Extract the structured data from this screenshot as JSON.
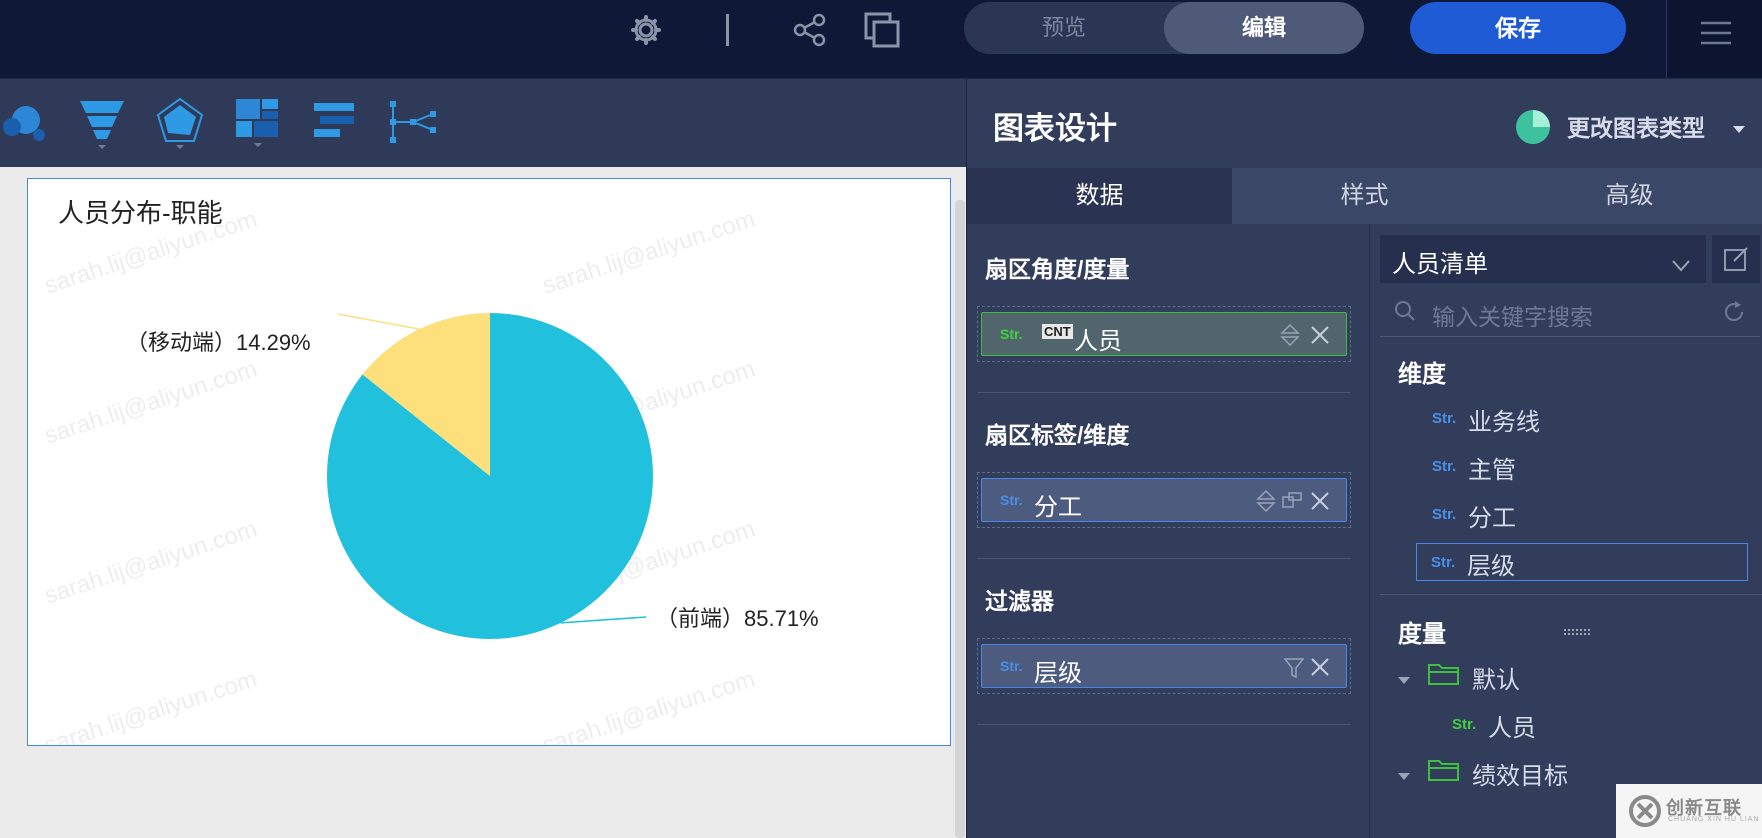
{
  "topbar": {
    "mode_tabs": [
      {
        "label": "预览",
        "active": false
      },
      {
        "label": "编辑",
        "active": true
      }
    ],
    "save_label": "保存",
    "icons": [
      "gear-icon",
      "share-icon",
      "copy-icon",
      "menu-icon"
    ]
  },
  "toolbar": {
    "chart_type_icons": [
      "bubble-chart-icon",
      "funnel-chart-icon",
      "radar-chart-icon",
      "treemap-chart-icon",
      "bar-list-icon",
      "tree-chart-icon"
    ]
  },
  "canvas": {
    "title": "人员分布-职能",
    "watermark": "sarah.lij@aliyun.com",
    "legend_labels": [
      "（移动端）14.29%",
      "（前端）85.71%"
    ]
  },
  "chart_data": {
    "type": "pie",
    "title": "人员分布-职能",
    "categories": [
      "前端",
      "移动端"
    ],
    "values": [
      85.71,
      14.29
    ],
    "colors": [
      "#21c0dc",
      "#fddf7c"
    ]
  },
  "panel": {
    "title": "图表设计",
    "change_type_label": "更改图表类型",
    "tabs": [
      {
        "label": "数据",
        "active": true
      },
      {
        "label": "样式",
        "active": false
      },
      {
        "label": "高级",
        "active": false
      }
    ],
    "sections": [
      {
        "title": "扇区角度/度量",
        "pill_type": "Str.",
        "pill_badge": "CNT",
        "pill_name": "人员"
      },
      {
        "title": "扇区标签/维度",
        "pill_type": "Str.",
        "pill_name": "分工"
      },
      {
        "title": "过滤器",
        "pill_type": "Str.",
        "pill_name": "层级"
      }
    ],
    "dataset": {
      "name": "人员清单",
      "search_placeholder": "输入关键字搜索"
    },
    "dimension_title": "维度",
    "dimensions": [
      {
        "type": "Str.",
        "name": "业务线"
      },
      {
        "type": "Str.",
        "name": "主管"
      },
      {
        "type": "Str.",
        "name": "分工"
      },
      {
        "type": "Str.",
        "name": "层级",
        "selected": true
      }
    ],
    "measure_title": "度量",
    "measure_folders": [
      {
        "name": "默认",
        "items": [
          {
            "type": "Str.",
            "name": "人员"
          }
        ]
      },
      {
        "name": "绩效目标",
        "items": []
      }
    ]
  },
  "brand": {
    "name": "创新互联",
    "sub": "CHUANG XIN HU LIAN"
  },
  "colors": {
    "accent": "#1f5bd4",
    "panel": "#323d5c",
    "topbar": "#0f1836"
  }
}
